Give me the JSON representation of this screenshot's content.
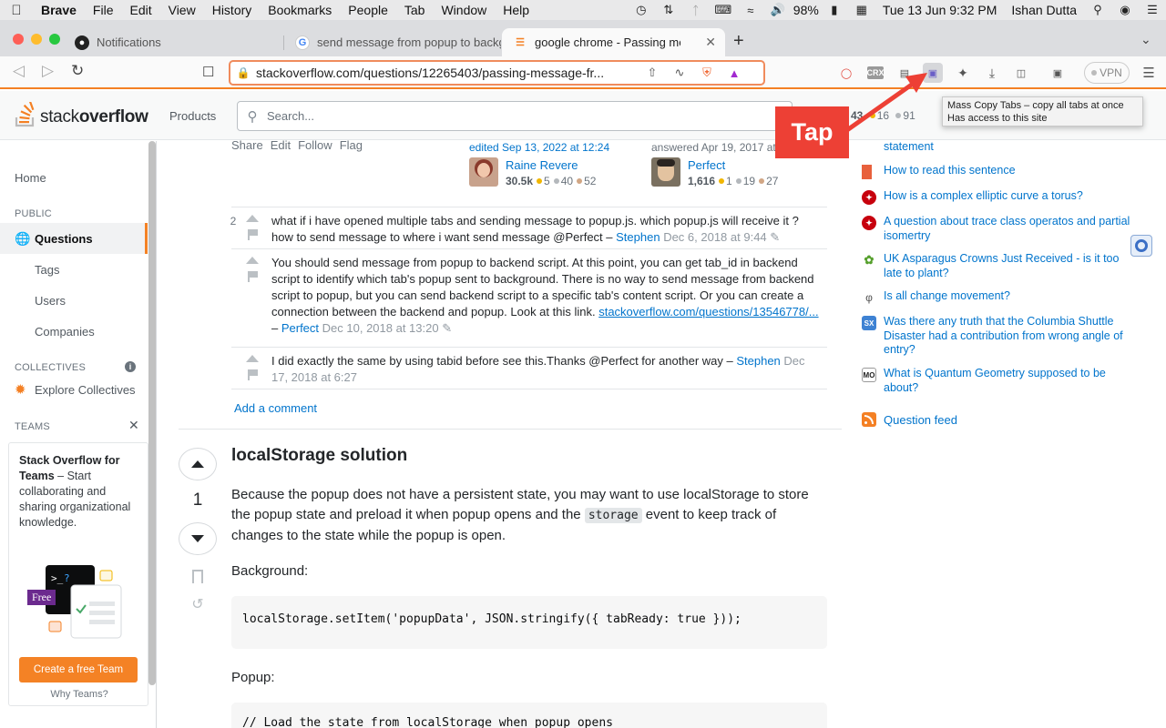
{
  "menubar": {
    "app": "Brave",
    "items": [
      "File",
      "Edit",
      "View",
      "History",
      "Bookmarks",
      "People",
      "Tab",
      "Window",
      "Help"
    ],
    "battery": "98%",
    "datetime": "Tue 13 Jun  9:32 PM",
    "user": "Ishan Dutta"
  },
  "tabs": [
    {
      "title": "Notifications"
    },
    {
      "title": "send message from popup to backg"
    },
    {
      "title": "google chrome - Passing messa"
    }
  ],
  "toolbar": {
    "url": "stackoverflow.com/questions/12265403/passing-message-fr...",
    "crx": "CRX",
    "vpn": "VPN"
  },
  "so": {
    "logo_plain": "stack",
    "logo_bold": "overflow",
    "products": "Products",
    "search_placeholder": "Search...",
    "rep_a": "43",
    "rep_gold": "16",
    "rep_silver": "91"
  },
  "leftnav": {
    "home": "Home",
    "public": "PUBLIC",
    "questions": "Questions",
    "tags": "Tags",
    "users": "Users",
    "companies": "Companies",
    "collectives": "COLLECTIVES",
    "explore": "Explore Collectives",
    "teams": "TEAMS",
    "teams_title": "Stack Overflow for Teams",
    "teams_body": " – Start collaborating and sharing organizational knowledge.",
    "free": "Free",
    "create_team": "Create a free Team",
    "why_teams": "Why Teams?"
  },
  "post": {
    "menu": [
      "Share",
      "Edit",
      "Follow",
      "Flag"
    ],
    "editor": {
      "action": "edited Sep 13, 2022 at 12:24",
      "name": "Raine Revere",
      "rep": "30.5k",
      "gold": "5",
      "silver": "40",
      "bronze": "52"
    },
    "author": {
      "action": "answered Apr 19, 2017 at",
      "name": "Perfect",
      "rep": "1,616",
      "gold": "1",
      "silver": "19",
      "bronze": "27"
    }
  },
  "comments": [
    {
      "score": "2",
      "text": "what if i have opened multiple tabs and sending message to popup.js. which popup.js will receive it ? how to send message to where i want send message @Perfect – ",
      "user": "Stephen",
      "date": "Dec 6, 2018 at 9:44"
    },
    {
      "score": "",
      "text": "You should send message from popup to backend script. At this point, you can get tab_id in backend script to identify which tab's popup sent to background. There is no way to send message from backend script to popup, but you can send backend script to a specific tab's content script. Or you can create a connection between the backend and popup. Look at this link. ",
      "link": "stackoverflow.com/questions/13546778/...",
      "sep": " – ",
      "user": "Perfect",
      "date": "Dec 10, 2018 at 13:20"
    },
    {
      "score": "",
      "text": "I did exactly the same by using tabid before see this.Thanks @Perfect for another way – ",
      "user": "Stephen",
      "date": "Dec 17, 2018 at 6:27"
    }
  ],
  "add_comment": "Add a comment",
  "answer": {
    "votes": "1",
    "title": "localStorage solution",
    "p1a": "Because the popup does not have a persistent state, you may want to use localStorage to store the popup state and preload it when popup opens and the ",
    "p1code": "storage",
    "p1b": " event to keep track of changes to the state while the popup is open.",
    "background": "Background:",
    "code1": "localStorage.setItem('popupData', JSON.stringify({ tabReady: true }));",
    "popup": "Popup:",
    "code2": "// Load the state from localStorage when popup opens"
  },
  "hot_questions": [
    {
      "text": "statement",
      "icon": "",
      "color": "#0074cc"
    },
    {
      "text": "How to read this sentence",
      "icon": "",
      "color": "#e8603c"
    },
    {
      "text": "How is a complex elliptic curve a torus?",
      "icon": "",
      "color": "#c7000d"
    },
    {
      "text": "A question about trace class operatos and partial isomertry",
      "icon": "",
      "color": "#c7000d"
    },
    {
      "text": "UK Asparagus Crowns Just Received - is it too late to plant?",
      "icon": "",
      "color": "#56a02d"
    },
    {
      "text": "Is all change movement?",
      "icon": "φ",
      "color": "#ffffff"
    },
    {
      "text": "Was there any truth that the Columbia Shuttle Disaster had a contribution from wrong angle of entry?",
      "icon": "SX",
      "color": "#3e82d3"
    },
    {
      "text": "What is Quantum Geometry supposed to be about?",
      "icon": "MO",
      "color": "#ffffff"
    }
  ],
  "question_feed": "Question feed",
  "tooltip": {
    "line1": "Mass Copy Tabs – copy all tabs at once",
    "line2": "Has access to this site"
  },
  "annotation": {
    "label": "Tap",
    "color": "#ed4035"
  },
  "colors": {
    "so_orange": "#f48024",
    "link_blue": "#0074cc",
    "gold": "#f1b600",
    "silver": "#b4b8bc",
    "bronze": "#d1a684"
  }
}
